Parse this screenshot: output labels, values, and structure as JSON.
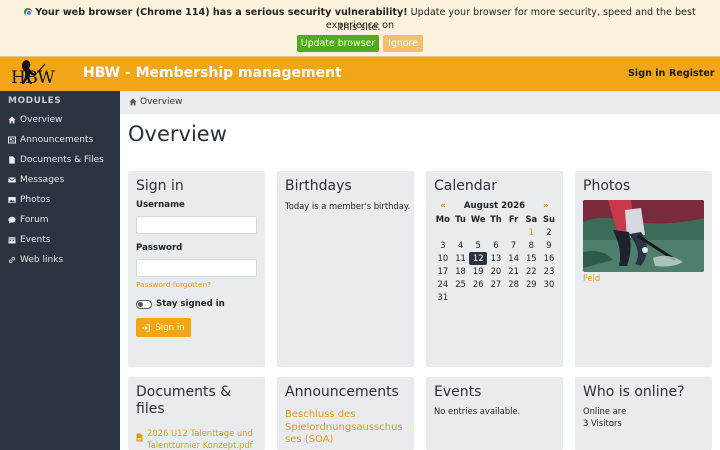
{
  "warning": {
    "bold_text": "Your web browser (Chrome 114) has a serious security vulnerability!",
    "text_rest": " Update your browser for more security, speed and the best experience on",
    "text_line2": "this site.",
    "update_label": "Update browser",
    "ignore_label": "Ignore",
    "icon": "chrome-icon"
  },
  "header": {
    "logo_text": "HBW",
    "title": "HBW - Membership management",
    "signin_label": "Sign in",
    "register_label": "Register",
    "color": "#f2a516"
  },
  "sidebar": {
    "heading": "MODULES",
    "items": [
      {
        "label": "Overview",
        "icon": "home-icon"
      },
      {
        "label": "Announcements",
        "icon": "newspaper-icon"
      },
      {
        "label": "Documents & Files",
        "icon": "file-icon"
      },
      {
        "label": "Messages",
        "icon": "envelope-icon"
      },
      {
        "label": "Photos",
        "icon": "image-icon"
      },
      {
        "label": "Forum",
        "icon": "chat-icon"
      },
      {
        "label": "Events",
        "icon": "calendar-icon"
      },
      {
        "label": "Web links",
        "icon": "link-icon"
      }
    ]
  },
  "breadcrumb": {
    "label": "Overview"
  },
  "main": {
    "title": "Overview"
  },
  "signin_card": {
    "title": "Sign in",
    "username_label": "Username",
    "password_label": "Password",
    "forgot_label": "Password forgotten?",
    "stay_label": "Stay signed in",
    "button_label": "Sign in"
  },
  "birthdays_card": {
    "title": "Birthdays",
    "text": "Today is a member's birthday."
  },
  "calendar_card": {
    "title": "Calendar",
    "prev": "«",
    "next": "»",
    "month": "August 2026",
    "weekdays": [
      "Mo",
      "Tu",
      "We",
      "Th",
      "Fr",
      "Sa",
      "Su"
    ],
    "weeks": [
      [
        "",
        "",
        "",
        "",
        "",
        "1",
        "2"
      ],
      [
        "3",
        "4",
        "5",
        "6",
        "7",
        "8",
        "9"
      ],
      [
        "10",
        "11",
        "12",
        "13",
        "14",
        "15",
        "16"
      ],
      [
        "17",
        "18",
        "19",
        "20",
        "21",
        "22",
        "23"
      ],
      [
        "24",
        "25",
        "26",
        "27",
        "28",
        "29",
        "30"
      ],
      [
        "31",
        "",
        "",
        "",
        "",
        "",
        ""
      ]
    ],
    "today": "12",
    "highlighted": [
      "1"
    ]
  },
  "photos_card": {
    "title": "Photos",
    "caption": "Feld"
  },
  "documents_card": {
    "title_line1": "Documents &",
    "title_line2": "files",
    "doc_line1": "2026 U12 Talenttage und",
    "doc_line2": "Talentturnier Konzept.pdf"
  },
  "announcements_card": {
    "title": "Announcements",
    "link_line1": "Beschluss des",
    "link_line2": "Spielordnungsausschus",
    "link_line3": "ses (SOA)"
  },
  "events_card": {
    "title": "Events",
    "text": "No entries available."
  },
  "online_card": {
    "title": "Who is online?",
    "line1": "Online are",
    "line2": "3 Visitors"
  }
}
